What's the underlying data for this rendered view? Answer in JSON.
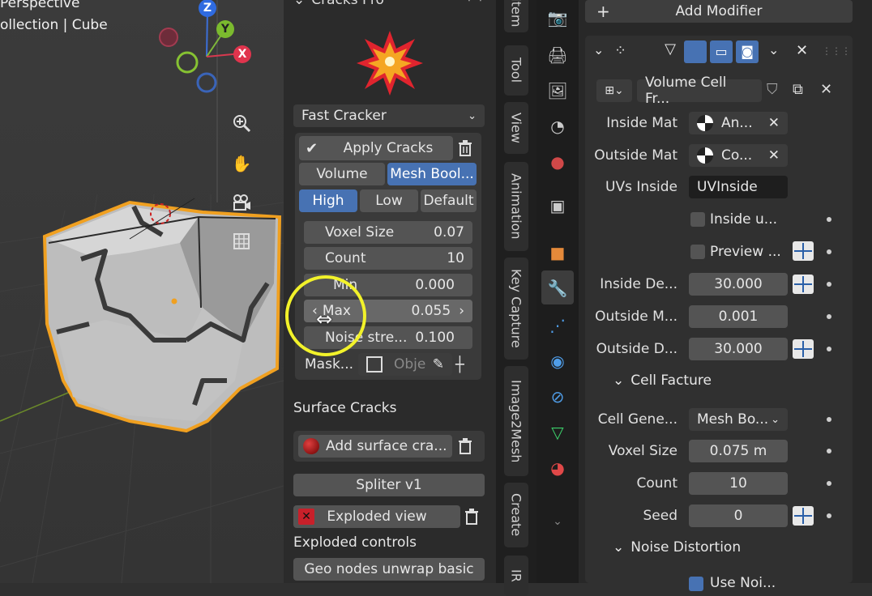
{
  "viewport": {
    "view_name": "Perspective",
    "collection": "ollection | Cube",
    "gizmo": {
      "z": "Z",
      "y": "Y",
      "x": "X"
    }
  },
  "addon_panel": {
    "title": "Cracks Pro",
    "mode_select": "Fast Cracker",
    "apply_label": "Apply Cracks",
    "type_options": [
      "Volume",
      "Mesh Bool..."
    ],
    "type_selected": "Mesh Bool...",
    "quality_options": [
      "High",
      "Low",
      "Default"
    ],
    "quality_selected": "High",
    "fields": [
      {
        "label": "Voxel Size",
        "value": "0.07"
      },
      {
        "label": "Count",
        "value": "10"
      },
      {
        "label": "Min",
        "value": "0.000"
      },
      {
        "label": "Max",
        "value": "0.055"
      },
      {
        "label": "Noise stre...",
        "value": "0.100"
      }
    ],
    "mask_label": "Mask...",
    "mask_placeholder": "Obje",
    "surface_header": "Surface Cracks",
    "surface_button": "Add surface cra...",
    "spliter_button": "Spliter v1",
    "exploded_button": "Exploded view",
    "exploded_controls": "Exploded controls",
    "geo_button": "Geo nodes unwrap basic"
  },
  "sidebar_tabs": [
    "Item",
    "Tool",
    "View",
    "Animation",
    "Key Capture",
    "Image2Mesh",
    "Create",
    "IR"
  ],
  "properties": {
    "add_modifier": "Add Modifier",
    "modifier_name": "Volume Cell Fr...",
    "inside_mat_label": "Inside Mat",
    "inside_mat_value": "An...",
    "outside_mat_label": "Outside Mat",
    "outside_mat_value": "Co...",
    "uvs_inside_label": "UVs Inside",
    "uvs_inside_value": "UVInside",
    "inside_u_label": "Inside u...",
    "preview_label": "Preview ...",
    "inside_de_label": "Inside De...",
    "inside_de_value": "30.000",
    "outside_m_label": "Outside M...",
    "outside_m_value": "0.001",
    "outside_d_label": "Outside D...",
    "outside_d_value": "30.000",
    "cell_facture_header": "Cell Facture",
    "cell_gene_label": "Cell Gene...",
    "cell_gene_value": "Mesh Bo...",
    "voxel_size_label": "Voxel Size",
    "voxel_size_value": "0.075 m",
    "count_label": "Count",
    "count_value": "10",
    "seed_label": "Seed",
    "seed_value": "0",
    "noise_header": "Noise Distortion",
    "use_noise_label": "Use Noi..."
  },
  "colors": {
    "accent_blue": "#4772b3",
    "selection_orange": "#f0a020",
    "cursor_yellow": "#f2f22a"
  }
}
